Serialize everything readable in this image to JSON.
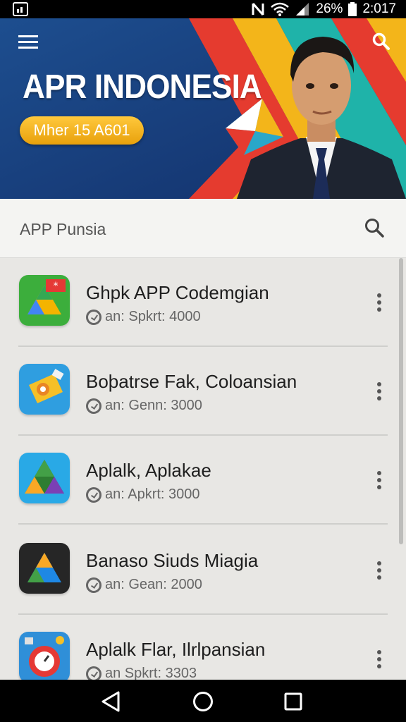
{
  "status_bar": {
    "battery": "26%",
    "time": "2:017",
    "icons": [
      "screenshot-icon",
      "nfc-icon",
      "wifi-icon",
      "signal-icon",
      "battery-icon"
    ]
  },
  "hero": {
    "title": "APR INDONESIA",
    "badge": "Mher 15 A601",
    "colors": {
      "background": "#1b3f7a",
      "badge": "#f0b020"
    }
  },
  "search": {
    "label": "APP Punsia"
  },
  "apps": [
    {
      "title": "Ghpk APP Codemgian",
      "meta": "an: Spkrt: 4000",
      "icon": "drive-green-icon"
    },
    {
      "title": "Boþatrse Fak, Coloansian",
      "meta": "an: Genn: 3000",
      "icon": "blue-tag-icon"
    },
    {
      "title": "Aplalk, Aplakae",
      "meta": "an: Apkrt: 3000",
      "icon": "drive-blue-icon"
    },
    {
      "title": "Banaso Siuds Miagia",
      "meta": "an: Gean: 2000",
      "icon": "drive-dark-icon"
    },
    {
      "title": "Aplalk Flar, Ilrlpansian",
      "meta": "an Spkrt: 3303",
      "icon": "red-clock-icon"
    }
  ],
  "navbar": {
    "icons": [
      "back-icon",
      "home-icon",
      "recents-icon"
    ]
  }
}
